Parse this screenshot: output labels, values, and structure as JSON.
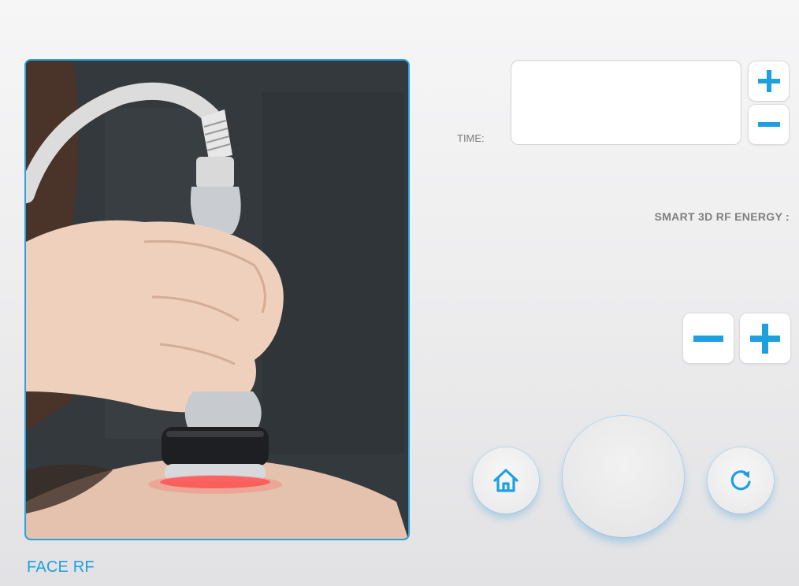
{
  "photo": {
    "caption": "FACE RF"
  },
  "time": {
    "label": "TIME:",
    "value": ""
  },
  "energy": {
    "label": "SMART 3D RF ENERGY :"
  },
  "colors": {
    "accent": "#1e9fe0",
    "frame": "#29a3e0",
    "label_gray": "#7b7b7b"
  },
  "icons": {
    "time_increase": "plus-icon",
    "time_decrease": "minus-icon",
    "energy_decrease": "minus-icon",
    "energy_increase": "plus-icon",
    "home": "home-icon",
    "reset": "refresh-icon"
  }
}
